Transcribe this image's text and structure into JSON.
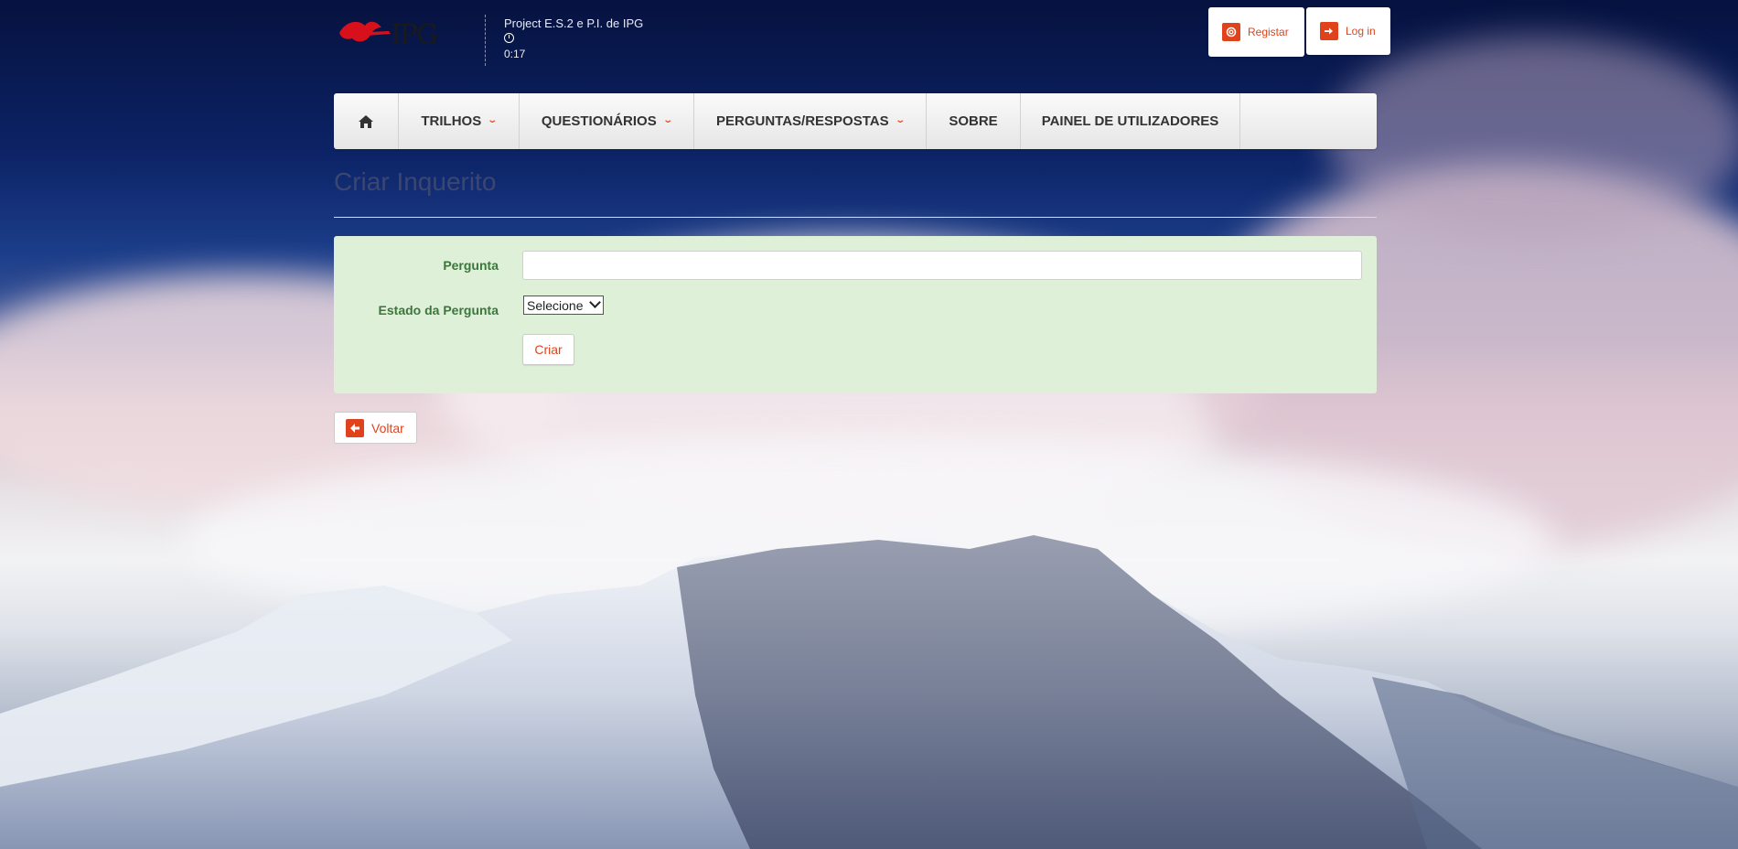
{
  "header": {
    "project_name": "Project E.S.2 e P.I. de IPG",
    "timer": "0:17"
  },
  "auth": {
    "register_label": "Registar",
    "login_label": "Log in"
  },
  "nav": {
    "items": [
      {
        "label": "TRILHOS",
        "dropdown": true
      },
      {
        "label": "QUESTIONÁRIOS",
        "dropdown": true
      },
      {
        "label": "PERGUNTAS/RESPOSTAS",
        "dropdown": true
      },
      {
        "label": "SOBRE",
        "dropdown": false
      },
      {
        "label": "PAINEL DE UTILIZADORES",
        "dropdown": false
      }
    ]
  },
  "page": {
    "title": "Criar Inquerito"
  },
  "form": {
    "pergunta_label": "Pergunta",
    "pergunta_value": "",
    "estado_label": "Estado da Pergunta",
    "estado_selected": "Selecione",
    "submit_label": "Criar"
  },
  "back": {
    "label": "Voltar"
  },
  "colors": {
    "accent": "#e0431c",
    "form_bg": "#dff0d8",
    "label_green": "#3c763d",
    "navbar_bg": "#f0f0f0"
  }
}
